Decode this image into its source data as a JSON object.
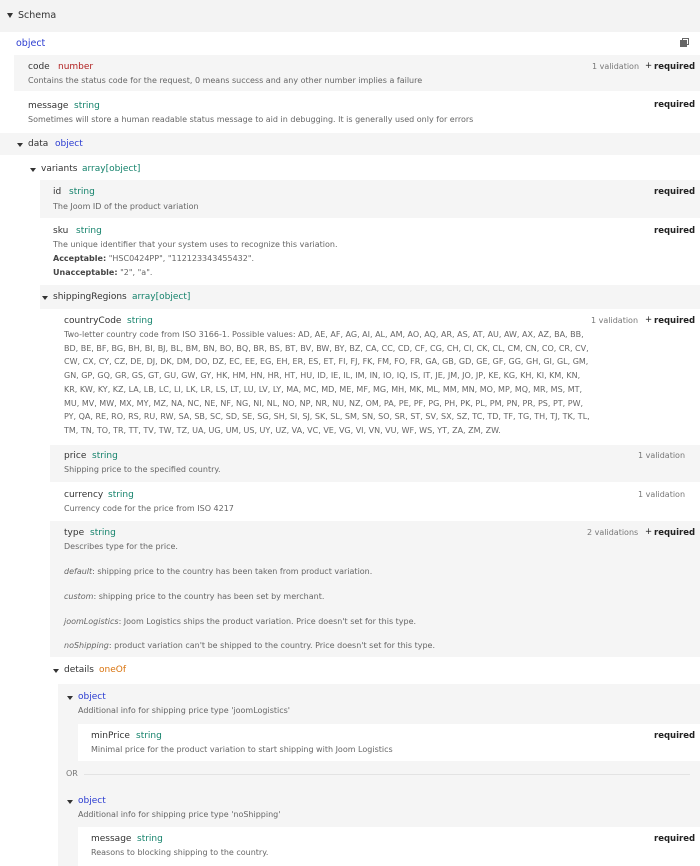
{
  "header": {
    "title": "Schema",
    "root_type": "object"
  },
  "props": {
    "code": {
      "name": "code",
      "type": "number",
      "desc": "Contains the status code for the request, 0 means success and any other number implies a failure",
      "validations": "1 validation",
      "required": "required"
    },
    "message": {
      "name": "message",
      "type": "string",
      "desc": "Sometimes will store a human readable status message to aid in debugging. It is generally used only for errors",
      "required": "required"
    },
    "data": {
      "name": "data",
      "type": "object"
    },
    "variants": {
      "name": "variants",
      "type": "array[object]"
    },
    "id": {
      "name": "id",
      "type": "string",
      "desc": "The Joom ID of the product variation",
      "required": "required"
    },
    "sku": {
      "name": "sku",
      "type": "string",
      "desc": "The unique identifier that your system uses to recognize this variation.",
      "acceptable_label": "Acceptable:",
      "acceptable": "\"HSC0424PP\", \"112123343455432\".",
      "unacceptable_label": "Unacceptable:",
      "unacceptable": "\"2\", \"a\".",
      "required": "required"
    },
    "shippingRegions": {
      "name": "shippingRegions",
      "type": "array[object]"
    },
    "countryCode": {
      "name": "countryCode",
      "type": "string",
      "desc": "Two-letter country code from ISO 3166-1. Possible values: AD, AE, AF, AG, AI, AL, AM, AO, AQ, AR, AS, AT, AU, AW, AX, AZ, BA, BB, BD, BE, BF, BG, BH, BI, BJ, BL, BM, BN, BO, BQ, BR, BS, BT, BV, BW, BY, BZ, CA, CC, CD, CF, CG, CH, CI, CK, CL, CM, CN, CO, CR, CV, CW, CX, CY, CZ, DE, DJ, DK, DM, DO, DZ, EC, EE, EG, EH, ER, ES, ET, FI, FJ, FK, FM, FO, FR, GA, GB, GD, GE, GF, GG, GH, GI, GL, GM, GN, GP, GQ, GR, GS, GT, GU, GW, GY, HK, HM, HN, HR, HT, HU, ID, IE, IL, IM, IN, IO, IQ, IS, IT, JE, JM, JO, JP, KE, KG, KH, KI, KM, KN, KR, KW, KY, KZ, LA, LB, LC, LI, LK, LR, LS, LT, LU, LV, LY, MA, MC, MD, ME, MF, MG, MH, MK, ML, MM, MN, MO, MP, MQ, MR, MS, MT, MU, MV, MW, MX, MY, MZ, NA, NC, NE, NF, NG, NI, NL, NO, NP, NR, NU, NZ, OM, PA, PE, PF, PG, PH, PK, PL, PM, PN, PR, PS, PT, PW, PY, QA, RE, RO, RS, RU, RW, SA, SB, SC, SD, SE, SG, SH, SI, SJ, SK, SL, SM, SN, SO, SR, ST, SV, SX, SZ, TC, TD, TF, TG, TH, TJ, TK, TL, TM, TN, TO, TR, TT, TV, TW, TZ, UA, UG, UM, US, UY, UZ, VA, VC, VE, VG, VI, VN, VU, WF, WS, YT, ZA, ZM, ZW.",
      "validations": "1 validation",
      "required": "required"
    },
    "price": {
      "name": "price",
      "type": "string",
      "desc": "Shipping price to the specified country.",
      "validations": "1 validation"
    },
    "currency": {
      "name": "currency",
      "type": "string",
      "desc": "Currency code for the price from ISO 4217",
      "validations": "1 validation"
    },
    "type": {
      "name": "type",
      "type": "string",
      "desc": "Describes type for the price.",
      "enum": [
        {
          "key": "default",
          "text": ": shipping price to the country has been taken from product variation."
        },
        {
          "key": "custom",
          "text": ": shipping price to the country has been set by merchant."
        },
        {
          "key": "joomLogistics",
          "text": ": Joom Logistics ships the product variation. Price doesn't set for this type."
        },
        {
          "key": "noShipping",
          "text": ": product variation can't be shipped to the country. Price doesn't set for this type."
        }
      ],
      "validations": "2 validations",
      "required": "required"
    },
    "details": {
      "name": "details",
      "type": "oneOf"
    },
    "obj1": {
      "type": "object",
      "desc": "Additional info for shipping price type 'joomLogistics'"
    },
    "minPrice": {
      "name": "minPrice",
      "type": "string",
      "desc": "Minimal price for the product variation to start shipping with Joom Logistics",
      "required": "required"
    },
    "or_label": "OR",
    "obj2": {
      "type": "object",
      "desc": "Additional info for shipping price type 'noShipping'"
    },
    "message2": {
      "name": "message",
      "type": "string",
      "desc": "Reasons to blocking shipping to the country.",
      "required": "required"
    }
  },
  "plus_symbol": "+",
  "icons": {
    "expand": "triangle-down-icon",
    "copy": "copy-icon"
  }
}
